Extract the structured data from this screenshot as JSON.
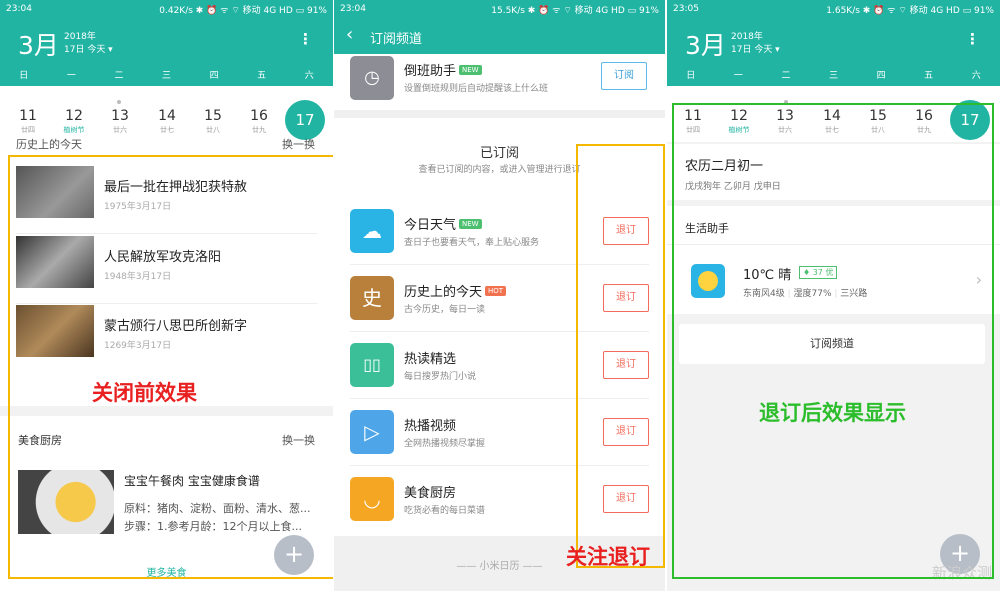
{
  "left": {
    "status": {
      "time": "23:04",
      "right": "0.42K/s ✱ ⏰ ᯤ ⌔ 移动 4G HD ▭ 91%"
    },
    "calendar": {
      "month": "3月",
      "year": "2018年",
      "day": "17日 今天 ▾",
      "menu": "⋮"
    },
    "weekdays": [
      "日",
      "一",
      "二",
      "三",
      "四",
      "五",
      "六"
    ],
    "dates": [
      {
        "num": "11",
        "lunar": "廿四"
      },
      {
        "num": "12",
        "lunar": "植树节"
      },
      {
        "num": "13",
        "lunar": "廿六"
      },
      {
        "num": "14",
        "lunar": "廿七"
      },
      {
        "num": "15",
        "lunar": "廿八"
      },
      {
        "num": "16",
        "lunar": "廿九"
      },
      {
        "num": "17",
        "lunar": ""
      }
    ],
    "history_cut_title": "历史上的今天",
    "history_cut_action": "换一换",
    "history": [
      {
        "title": "最后一批在押战犯获特赦",
        "date": "1975年3月17日"
      },
      {
        "title": "人民解放军攻克洛阳",
        "date": "1948年3月17日"
      },
      {
        "title": "蒙古颁行八思巴所创新字",
        "date": "1269年3月17日"
      }
    ],
    "annotation": "关闭前效果",
    "food": {
      "section_title": "美食厨房",
      "refresh": "换一换",
      "title": "宝宝午餐肉 宝宝健康食谱",
      "ingredients": "原料：猪肉、淀粉、面粉、清水、葱...",
      "steps": "步骤：1.参考月龄：12个月以上食...",
      "more": "更多美食"
    },
    "fab": "+"
  },
  "middle": {
    "status": {
      "time": "23:04",
      "right": "15.5K/s ✱ ⏰ ᯤ ⌔ 移动 4G HD ▭ 91%"
    },
    "header": {
      "back": "‹",
      "title": "订阅频道"
    },
    "top_item": {
      "name": "倒班助手",
      "badge": "NEW",
      "desc": "设置倒班规则后自动提醒该上什么班",
      "button": "订阅"
    },
    "subscribed": {
      "title": "已订阅",
      "desc": "查看已订阅的内容，或进入管理进行退订"
    },
    "items": [
      {
        "name": "今日天气",
        "badge": "NEW",
        "desc": "查日子也要看天气，奉上贴心服务",
        "button": "退订",
        "icon": "☁",
        "color": "#2ab4e6",
        "badge_color": "#4cc070"
      },
      {
        "name": "历史上的今天",
        "badge": "HOT",
        "desc": "古今历史，每日一读",
        "button": "退订",
        "icon": "史",
        "color": "#b9803c",
        "badge_color": "#f2724f"
      },
      {
        "name": "热读精选",
        "badge": "",
        "desc": "每日搜罗热门小说",
        "button": "退订",
        "icon": "▯▯",
        "color": "#3bbf98",
        "badge_color": ""
      },
      {
        "name": "热播视频",
        "badge": "",
        "desc": "全网热播视频尽掌握",
        "button": "退订",
        "icon": "▷",
        "color": "#4ea6e8",
        "badge_color": ""
      },
      {
        "name": "美食厨房",
        "badge": "",
        "desc": "吃货必看的每日菜谱",
        "button": "退订",
        "icon": "◡",
        "color": "#f5a623",
        "badge_color": ""
      }
    ],
    "footer": "—— 小米日历 ——",
    "annotation": "关注退订"
  },
  "right": {
    "status": {
      "time": "23:05",
      "right": "1.65K/s ✱ ⏰ ᯤ ⌔ 移动 4G HD ▭ 91%"
    },
    "calendar": {
      "month": "3月",
      "year": "2018年",
      "day": "17日 今天 ▾",
      "menu": "⋮"
    },
    "weekdays": [
      "日",
      "一",
      "二",
      "三",
      "四",
      "五",
      "六"
    ],
    "dates": [
      {
        "num": "11",
        "lunar": "廿四"
      },
      {
        "num": "12",
        "lunar": "植树节"
      },
      {
        "num": "13",
        "lunar": "廿六"
      },
      {
        "num": "14",
        "lunar": "廿七"
      },
      {
        "num": "15",
        "lunar": "廿八"
      },
      {
        "num": "16",
        "lunar": "廿九"
      },
      {
        "num": "17",
        "lunar": ""
      }
    ],
    "lunar": {
      "title": "农历二月初一",
      "sub": "戊戌狗年 乙卯月 戊申日"
    },
    "assistant": {
      "title": "生活助手",
      "temp": "10℃ 晴",
      "aqi": "♦ 37 优",
      "wind": "东南风4级",
      "humidity": "湿度77%",
      "location": "三兴路"
    },
    "subscribe_button": "订阅频道",
    "annotation": "退订后效果显示",
    "fab": "+",
    "watermark": "新浪众测"
  },
  "colors": {
    "teal": "#22b4a3",
    "annot_orange": "#f5b800",
    "annot_red": "#e8201f",
    "annot_green": "#2bbd2b"
  }
}
